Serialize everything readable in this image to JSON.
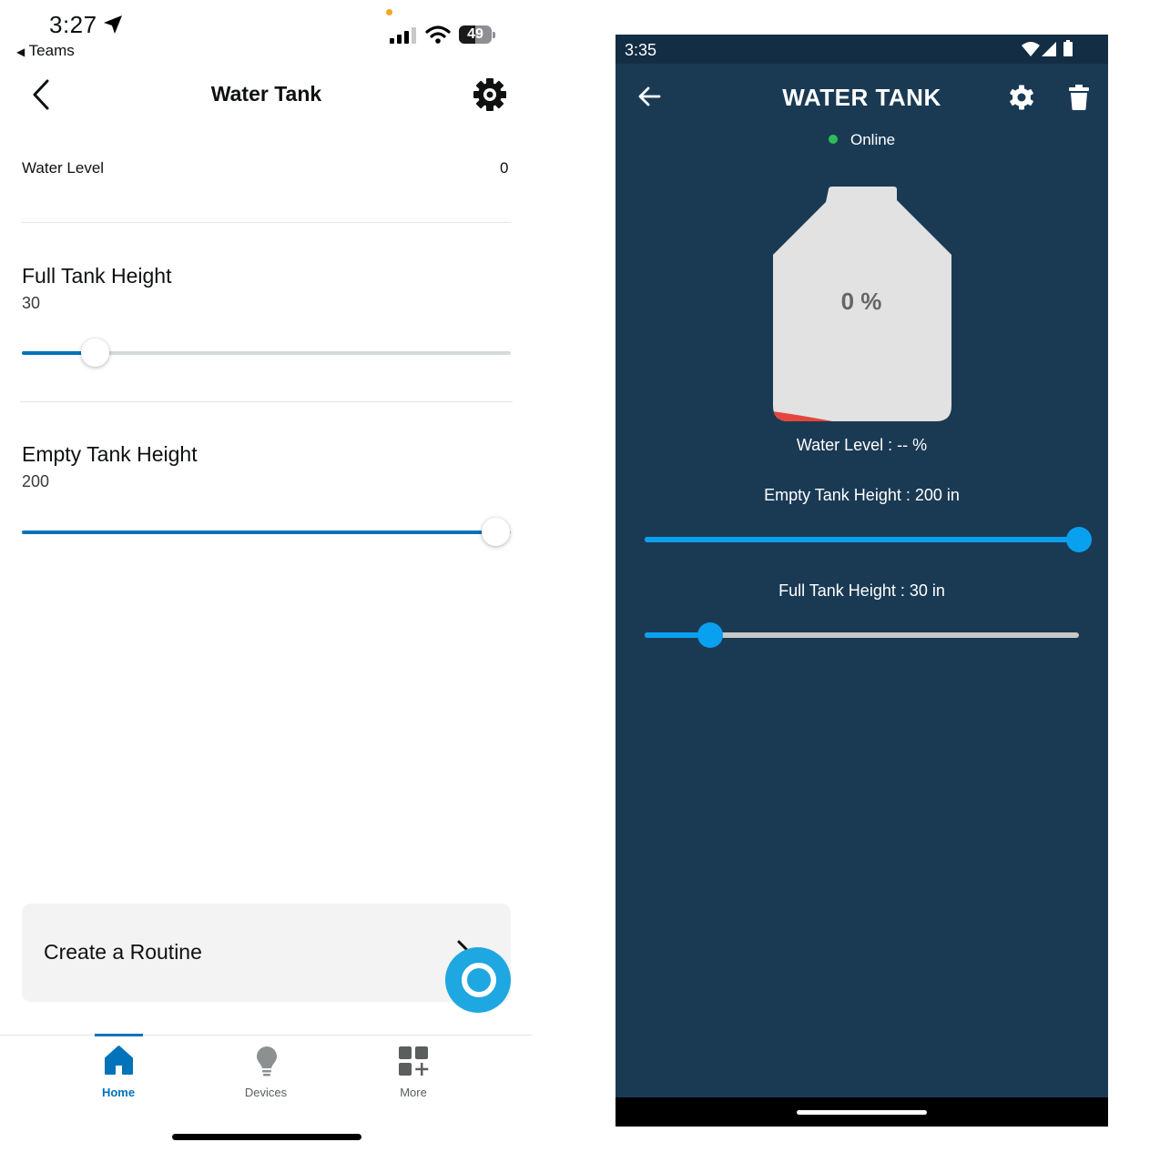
{
  "ios": {
    "status": {
      "time": "3:27",
      "back_app": "Teams",
      "battery": "49"
    },
    "header": {
      "title": "Water Tank"
    },
    "water_level": {
      "label": "Water Level",
      "value": "0"
    },
    "full_tank": {
      "title": "Full Tank Height",
      "value": "30",
      "slider_fraction": 0.15
    },
    "empty_tank": {
      "title": "Empty Tank Height",
      "value": "200",
      "slider_fraction": 0.97
    },
    "routine": {
      "label": "Create a Routine"
    },
    "tabs": [
      {
        "label": "Home",
        "icon": "home-icon",
        "active": true
      },
      {
        "label": "Devices",
        "icon": "bulb-icon",
        "active": false
      },
      {
        "label": "More",
        "icon": "more-grid-icon",
        "active": false
      }
    ],
    "colors": {
      "accent": "#0073bb",
      "alexa": "#1ea7e1"
    }
  },
  "android": {
    "status": {
      "time": "3:35"
    },
    "header": {
      "title": "WATER TANK"
    },
    "online": "Online",
    "tank_percent": "0 %",
    "water_level_text": "Water Level  : -- %",
    "empty_tank_text": "Empty Tank Height  : 200 in",
    "empty_slider_fraction": 1.0,
    "full_tank_text": "Full Tank Height  : 30 in",
    "full_slider_fraction": 0.15,
    "colors": {
      "background": "#1a3a54",
      "slider": "#0aa0f0",
      "online": "#2ebd59"
    }
  }
}
